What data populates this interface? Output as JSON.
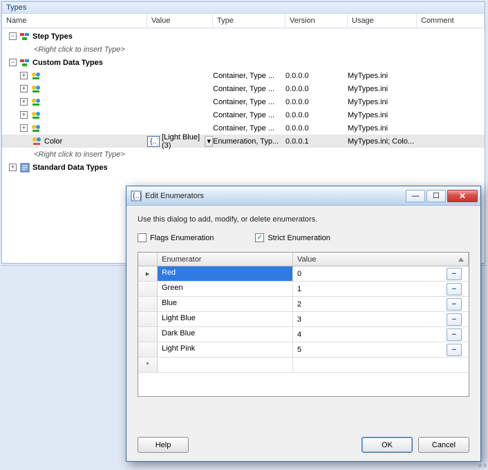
{
  "panel": {
    "title": "Types"
  },
  "columns": {
    "name": "Name",
    "value": "Value",
    "type": "Type",
    "version": "Version",
    "usage": "Usage",
    "comment": "Comment"
  },
  "tree": {
    "stepTypes": {
      "label": "Step Types",
      "hint": "<Right click to insert Type>"
    },
    "customDataTypes": {
      "label": "Custom Data Types",
      "containers": [
        {
          "type": "Container, Type ...",
          "version": "0.0.0.0",
          "usage": "MyTypes.ini"
        },
        {
          "type": "Container, Type ...",
          "version": "0.0.0.0",
          "usage": "MyTypes.ini"
        },
        {
          "type": "Container, Type ...",
          "version": "0.0.0.0",
          "usage": "MyTypes.ini"
        },
        {
          "type": "Container, Type ...",
          "version": "0.0.0.0",
          "usage": "MyTypes.ini"
        },
        {
          "type": "Container, Type ...",
          "version": "0.0.0.0",
          "usage": "MyTypes.ini"
        }
      ],
      "color": {
        "label": "Color",
        "value": "[Light Blue] (3)",
        "type": "Enumeration, Typ...",
        "version": "0.0.0.1",
        "usage": "MyTypes.ini; Colo..."
      },
      "hint": "<Right click to insert Type>"
    },
    "standardDataTypes": {
      "label": "Standard Data Types"
    }
  },
  "dialog": {
    "title": "Edit Enumerators",
    "instruction": "Use this dialog to add, modify, or delete enumerators.",
    "flagsLabel": "Flags Enumeration",
    "flagsChecked": false,
    "strictLabel": "Strict Enumeration",
    "strictChecked": true,
    "gridHeaders": {
      "enumerator": "Enumerator",
      "value": "Value"
    },
    "rows": [
      {
        "name": "Red",
        "value": "0",
        "selected": true
      },
      {
        "name": "Green",
        "value": "1"
      },
      {
        "name": "Blue",
        "value": "2"
      },
      {
        "name": "Light Blue",
        "value": "3"
      },
      {
        "name": "Dark Blue",
        "value": "4"
      },
      {
        "name": "Light Pink",
        "value": "5"
      }
    ],
    "buttons": {
      "help": "Help",
      "ok": "OK",
      "cancel": "Cancel"
    }
  },
  "twister": {
    "plus": "+",
    "minus": "−"
  },
  "glyph": {
    "arrowDown": "▾",
    "arrowRight": "▸",
    "asterisk": "*",
    "minus": "−",
    "close": "✕",
    "min": "—",
    "max": "☐"
  },
  "footer": "e s"
}
